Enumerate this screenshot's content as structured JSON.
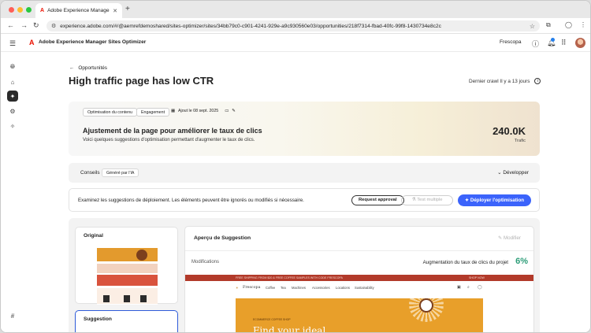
{
  "browser": {
    "tab_title": "Adobe Experience Manager S",
    "url": "experience.adobe.com/#/@aemrefdemoshared/sites-optimizer/sites/34bb79c0-c901-4241-929e-a9c930560e03/opportunities/218f7314-fbad-40fc-99f8-1430734e8c2c"
  },
  "header": {
    "app_title": "Adobe Experience Manager Sites Optimizer",
    "org": "Frescopa"
  },
  "page": {
    "back_label": "Opportunités",
    "title": "High traffic page has low CTR",
    "crawl": "Dernier crawl Il y a 13 jours"
  },
  "hero": {
    "chips": [
      "Optimisation du contenu",
      "Engagement"
    ],
    "added": "Ajout le 08 sept. 2025",
    "title": "Ajustement de la page pour améliorer le taux de clics",
    "subtitle": "Voici quelques suggestions d'optimisation permettant d'augmenter le taux de clics.",
    "traffic_value": "240.0K",
    "traffic_label": "Trafic"
  },
  "conseils": {
    "label": "Conseils",
    "ai_badge": "Généré par l'IA",
    "expand": "Développer"
  },
  "actions": {
    "text": "Examinez les suggestions de déploiement. Les éléments peuvent être ignorés ou modifiés si nécessaire.",
    "request_approval": "Request approval",
    "test_multiple": "Test multiple",
    "deploy": "Déployer l'optimisation"
  },
  "cards": {
    "original": "Original",
    "suggestion": "Suggestion"
  },
  "preview": {
    "title": "Aperçu de Suggestion",
    "modify": "Modifier",
    "modifications": "Modifications",
    "increase_label": "Augmentation du taux de clics du projet",
    "increase_value": "6%",
    "site_banner": "FREE SHIPPING FROM $20 & FREE COFFEE SAMPLES WITH CODE FRESCOPA",
    "site_shop": "SHOP NOW",
    "site_brand": "Frescopa",
    "site_nav": [
      "Coffee",
      "Tea",
      "Machines",
      "Accessories",
      "Locations",
      "Sustainability"
    ],
    "site_kicker": "ECOMMERCE COFFEE SHOP",
    "site_headline": "Find your ideal"
  },
  "colors": {
    "primary": "#3b63fb",
    "accent_green": "#2d9d78",
    "adobe_red": "#eb1000"
  }
}
